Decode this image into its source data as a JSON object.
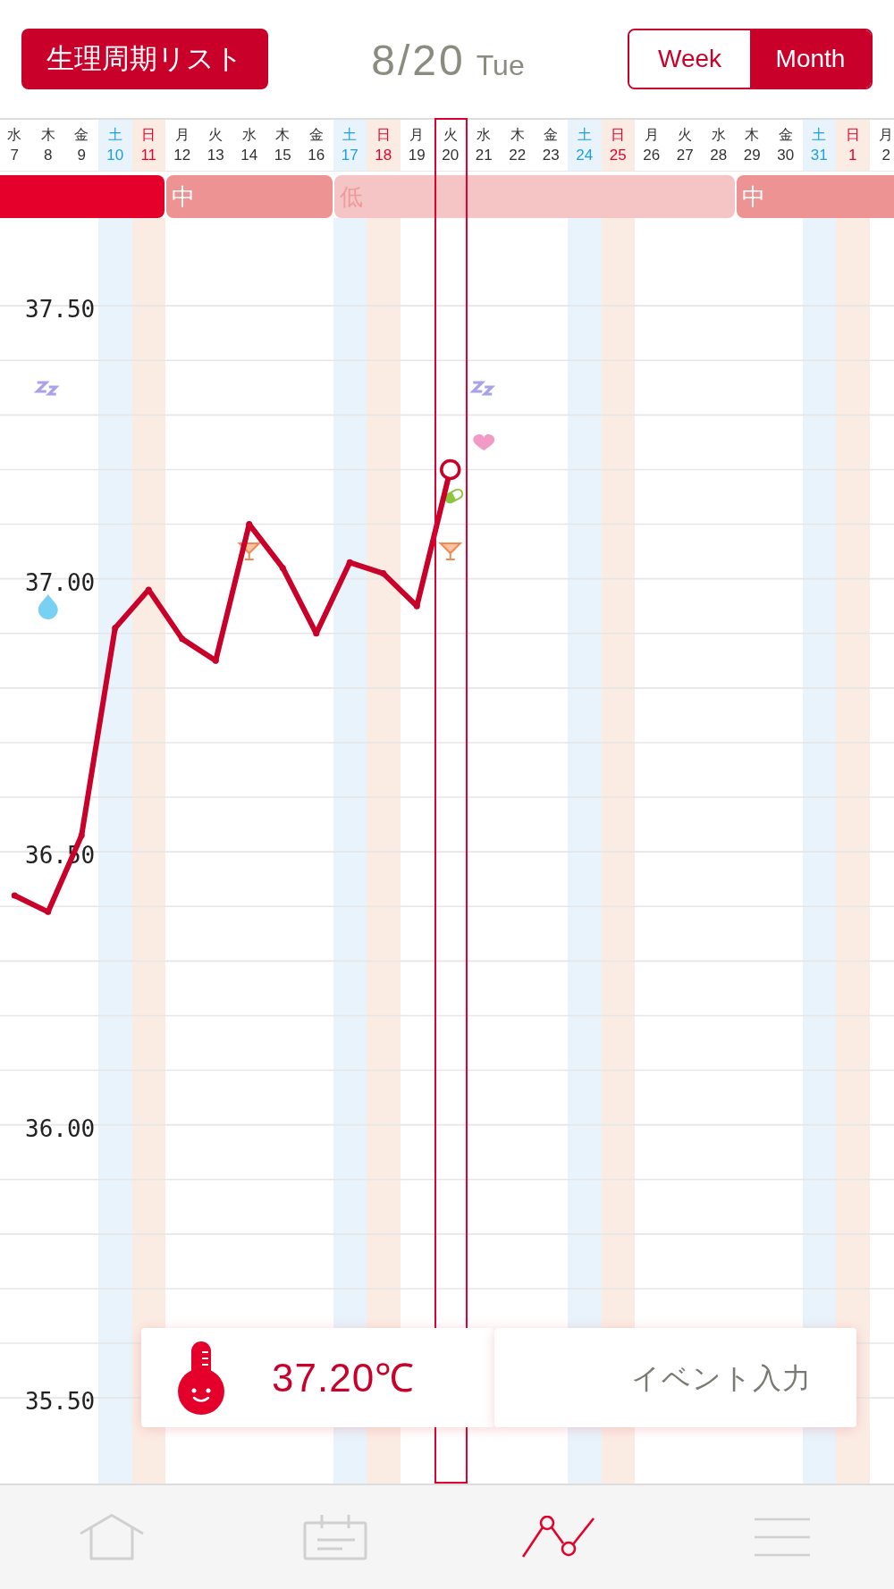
{
  "header": {
    "list_button": "生理周期リスト",
    "date": "8/20",
    "weekday": "Tue",
    "view_tabs": [
      {
        "label": "Week",
        "selected": false
      },
      {
        "label": "Month",
        "selected": true
      }
    ]
  },
  "phase_bar": {
    "ongoing": {
      "color": "#e4002b"
    }
  },
  "days": [
    {
      "weekday": "水",
      "kind": "weekday",
      "selected": false
    },
    {
      "weekday": "木",
      "kind": "weekday",
      "selected": false,
      "events": [
        {
          "kind": "sleep"
        },
        {
          "kind": "drop"
        }
      ]
    },
    {
      "weekday": "金",
      "kind": "weekday",
      "selected": false
    },
    {
      "weekday": "土",
      "kind": "saturday",
      "selected": false
    },
    {
      "weekday": "日",
      "kind": "sunday",
      "selected": false
    },
    {
      "weekday": "月",
      "kind": "weekday",
      "selected": false,
      "phase_start": {
        "label": "中",
        "color": "#ee9393"
      }
    },
    {
      "weekday": "火",
      "kind": "weekday",
      "selected": false
    },
    {
      "weekday": "水",
      "kind": "weekday",
      "selected": false,
      "events": [
        {
          "kind": "drink"
        }
      ]
    },
    {
      "weekday": "木",
      "kind": "weekday",
      "selected": false
    },
    {
      "weekday": "金",
      "kind": "weekday",
      "selected": false
    },
    {
      "weekday": "土",
      "kind": "saturday",
      "selected": false,
      "phase_start": {
        "label": "低",
        "color": "#f5c5c5"
      }
    },
    {
      "weekday": "日",
      "kind": "sunday",
      "selected": false
    },
    {
      "weekday": "月",
      "kind": "weekday",
      "selected": false
    },
    {
      "weekday": "火",
      "kind": "weekday",
      "selected": true,
      "events": [
        {
          "kind": "pill"
        },
        {
          "kind": "drink"
        }
      ]
    },
    {
      "weekday": "水",
      "kind": "weekday",
      "selected": false,
      "events": [
        {
          "kind": "sleep"
        },
        {
          "kind": "heart"
        }
      ]
    },
    {
      "weekday": "木",
      "kind": "weekday",
      "selected": false
    },
    {
      "weekday": "金",
      "kind": "weekday",
      "selected": false
    },
    {
      "weekday": "土",
      "kind": "saturday",
      "selected": false
    },
    {
      "weekday": "日",
      "kind": "sunday",
      "selected": false
    },
    {
      "weekday": "月",
      "kind": "weekday",
      "selected": false
    },
    {
      "weekday": "火",
      "kind": "weekday",
      "selected": false
    },
    {
      "weekday": "水",
      "kind": "weekday",
      "selected": false
    },
    {
      "weekday": "木",
      "kind": "weekday",
      "selected": false,
      "phase_start": {
        "label": "中",
        "color": "#ee9393"
      }
    },
    {
      "weekday": "金",
      "kind": "weekday",
      "selected": false
    },
    {
      "weekday": "土",
      "kind": "saturday",
      "selected": false
    },
    {
      "weekday": "日",
      "kind": "sunday",
      "selected": false
    },
    {
      "weekday": "月",
      "kind": "weekday",
      "selected": false
    }
  ],
  "chart_data": {
    "type": "line",
    "categories": [
      "7",
      "8",
      "9",
      "10",
      "11",
      "12",
      "13",
      "14",
      "15",
      "16",
      "17",
      "18",
      "19",
      "20",
      "21",
      "22",
      "23",
      "24",
      "25",
      "26",
      "27",
      "28",
      "29",
      "30",
      "31",
      "1",
      "2"
    ],
    "series": [
      {
        "color": "#c8002a",
        "marker": "circle",
        "values": [
          36.42,
          36.39,
          36.53,
          36.91,
          36.98,
          36.89,
          36.85,
          37.1,
          37.02,
          36.9,
          37.03,
          37.01,
          36.95,
          37.2,
          null,
          null,
          null,
          null,
          null,
          null,
          null,
          null,
          null,
          null,
          null,
          null,
          null
        ]
      }
    ],
    "ylim": [
      35.15,
      38.06
    ],
    "yticks": [
      {
        "value": 37.5,
        "label": "37.50"
      },
      {
        "value": 37.0,
        "label": "37.00"
      },
      {
        "value": 36.5,
        "label": "36.50"
      },
      {
        "value": 36.0,
        "label": "36.00"
      },
      {
        "value": 35.5,
        "label": "35.50"
      }
    ],
    "grid": true
  },
  "temperature_card": {
    "reading": "37.20℃"
  },
  "event_button": {
    "label": "イベント入力"
  },
  "nav": [
    {
      "kind": "home",
      "selected": false
    },
    {
      "kind": "calendar",
      "selected": false
    },
    {
      "kind": "chart",
      "selected": true
    },
    {
      "kind": "menu",
      "selected": false
    }
  ]
}
